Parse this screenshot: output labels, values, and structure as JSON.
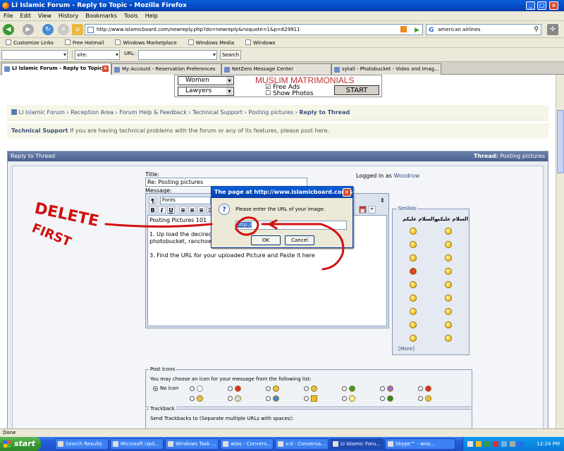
{
  "window": {
    "title": "LI Islamic Forum - Reply to Topic - Mozilla Firefox"
  },
  "menu": [
    "File",
    "Edit",
    "View",
    "History",
    "Bookmarks",
    "Tools",
    "Help"
  ],
  "nav": {
    "url": "http://www.islamicboard.com/newreply.php?do=newreply&noquote=1&p=829911",
    "search_value": "american airlines"
  },
  "links": [
    "Customize Links",
    "Free Hotmail",
    "Windows Marketplace",
    "Windows Media",
    "Windows"
  ],
  "toolbar3": {
    "site_label": "site:",
    "url_label": "URL:",
    "search_button": "Search"
  },
  "tabs": [
    {
      "label": "LI Islamic Forum - Reply to Topic",
      "active": true
    },
    {
      "label": "My Account - Reservation Preferences",
      "active": false
    },
    {
      "label": "NetZero Message Center",
      "active": false
    },
    {
      "label": "sytall - Photobucket - Video and Imag...",
      "active": false
    }
  ],
  "banner": {
    "select1": "Women",
    "select2": "Lawyers",
    "title": "MUSLIM MATRIMONIALS",
    "check1": "Free Ads",
    "check2": "Show Photos",
    "start": "START"
  },
  "breadcrumb": [
    "LI Islamic Forum",
    "Reception Area",
    "Forum Help & Feedback",
    "Technical Support",
    "Posting pictures",
    "Reply to Thread"
  ],
  "info": {
    "forum": "Technical Support",
    "desc": "If you are having technical problems with the forum or any of its features, please post here."
  },
  "panel": {
    "header": "Reply to Thread",
    "thread_label": "Thread:",
    "thread_name": "Posting pictures"
  },
  "form": {
    "title_label": "Title:",
    "title_value": "Re: Posting pictures",
    "logged_in_label": "Logged in as",
    "username": "Woodrow",
    "message_label": "Message:",
    "fonts": "Fonts",
    "lines": [
      "Posting Pictures 101",
      "",
      "1. Up load the decired",
      "photobucket, ranchowe",
      "",
      "3. Find the URL for your uploaded Picture and Paste it here"
    ]
  },
  "smilies": {
    "title": "Smilies",
    "header1": "والسلام عليكم",
    "header2": "السلام عليكم",
    "more": "[More]"
  },
  "post_icons": {
    "title": "Post Icons",
    "instruction": "You may choose an icon for your message from the following list:",
    "no_icon": "No icon"
  },
  "trackback": {
    "title": "Trackback",
    "instruction": "Send Trackbacks to (Separate multiple URLs with spaces):"
  },
  "dialog": {
    "title": "The page at http://www.islamicboard.com s...",
    "message": "Please enter the URL of your image:",
    "input_value": "http://",
    "ok": "OK",
    "cancel": "Cancel"
  },
  "annotation": {
    "line1": "DELETE",
    "line2": "FIRST",
    "color": "#d01010"
  },
  "status": "Done",
  "taskbar": {
    "start": "start",
    "items": [
      "Search Results",
      "Microsoft Upd...",
      "Windows Task ...",
      "wlas - Convers...",
      "v.d - Conversa...",
      "LI Islamic Foru...",
      "Skype™ - woo..."
    ],
    "time": "12:24 PM"
  }
}
